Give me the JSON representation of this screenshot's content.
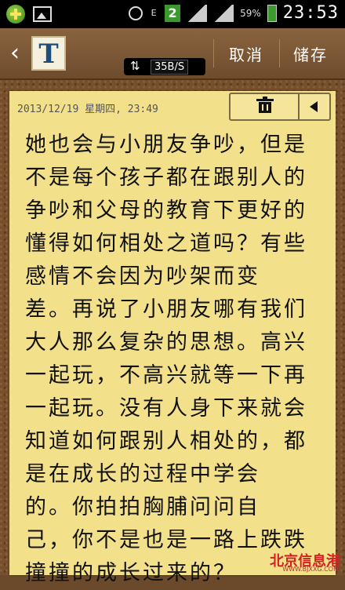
{
  "status_bar": {
    "signal_type": "E",
    "badge": "2",
    "battery_percent": "59%",
    "time": "23:53"
  },
  "toolbar": {
    "app_icon_letter": "T",
    "net_speed": "35B/S",
    "cancel_label": "取消",
    "save_label": "储存"
  },
  "note": {
    "date": "2013/12/19 星期四, 23:49",
    "lines": [
      "她也会与小朋友争吵，但是",
      "不是每个孩子都在跟别人的",
      "争吵和父母的教育下更好的",
      "懂得如何相处之道吗？有些",
      "感情不会因为吵架而变",
      "差。再说了小朋友哪有我们",
      "大人那么复杂的思想。高兴",
      "一起玩，不高兴就等一下再",
      "一起玩。没有人身下来就会",
      "知道如何跟别人相处的，都",
      "是在成长的过程中学会",
      "的。你拍拍胸脯问问自",
      "己，你不是也是一路上跌跌",
      "撞撞的成长过来的？"
    ]
  },
  "watermark": {
    "main": "北京信息港",
    "url": "WWW.BJXXG.COM"
  }
}
